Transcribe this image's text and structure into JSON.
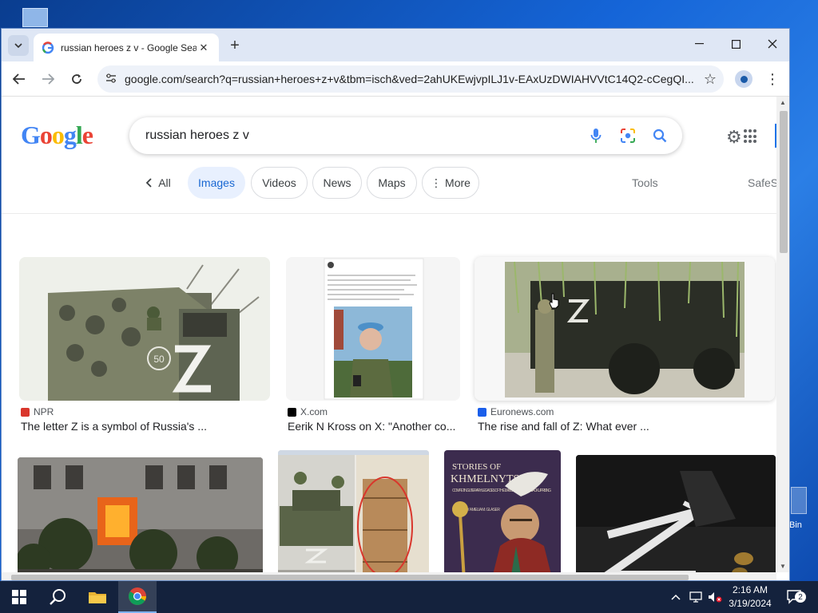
{
  "browser": {
    "tab_title": "russian heroes z v - Google Sea",
    "new_tab_label": "+",
    "url": "google.com/search?q=russian+heroes+z+v&tbm=isch&ved=2ahUKEwjvpILJ1v-EAxUzDWIAHVVtC14Q2-cCegQI..."
  },
  "search": {
    "logo_text": "Google",
    "query": "russian heroes z v"
  },
  "chips": [
    {
      "label": "All",
      "active": false
    },
    {
      "label": "Images",
      "active": true
    },
    {
      "label": "Videos",
      "active": false
    },
    {
      "label": "News",
      "active": false
    },
    {
      "label": "Maps",
      "active": false
    },
    {
      "label": "More",
      "active": false
    }
  ],
  "tools_label": "Tools",
  "safesearch_label": "SafeS",
  "results": [
    {
      "source": "NPR",
      "caption": "The letter Z is a symbol of Russia's ...",
      "favicon_color": "#d9362c"
    },
    {
      "source": "X.com",
      "caption": "Eerik N Kross on X: \"Another co...",
      "favicon_color": "#000000"
    },
    {
      "source": "Euronews.com",
      "caption": "The rise and fall of Z: What ever ...",
      "favicon_color": "#1a5eea"
    },
    {
      "source": "",
      "caption": ""
    },
    {
      "source": "",
      "caption": ""
    },
    {
      "source": "",
      "caption": ""
    },
    {
      "source": "",
      "caption": ""
    }
  ],
  "image_text": {
    "r1_badge": "50",
    "book_title_line1": "STORIES OF",
    "book_title_line2": "KHMELNYTSKY",
    "book_subtitle": "COMPETING LITERARY LEGACIES OF THE 1648 UKRAINIAN COSSACK UPRISING",
    "book_editor": "EDITED BY AMELIA M. GLASER"
  },
  "desktop": {
    "bin_label": "Bin"
  },
  "taskbar": {
    "time": "2:16 AM",
    "date": "3/19/2024",
    "notification_count": "2"
  }
}
